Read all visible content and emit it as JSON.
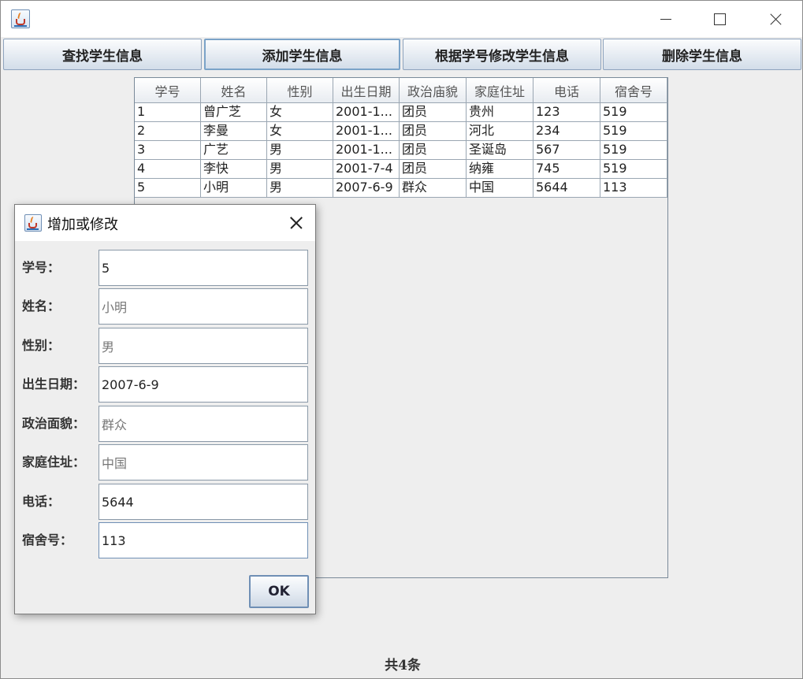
{
  "window": {
    "title": ""
  },
  "toolbar": {
    "find_label": "查找学生信息",
    "add_label": "添加学生信息",
    "modify_label": "根据学号修改学生信息",
    "delete_label": "删除学生信息"
  },
  "table": {
    "columns": [
      "学号",
      "姓名",
      "性别",
      "出生日期",
      "政治庙貌",
      "家庭住址",
      "电话",
      "宿舍号"
    ],
    "rows": [
      [
        "1",
        "曾广芝",
        "女",
        "2001-1...",
        "团员",
        "贵州",
        "123",
        "519"
      ],
      [
        "2",
        "李曼",
        "女",
        "2001-1...",
        "团员",
        "河北",
        "234",
        "519"
      ],
      [
        "3",
        "广艺",
        "男",
        "2001-1...",
        "团员",
        "圣诞岛",
        "567",
        "519"
      ],
      [
        "4",
        "李快",
        "男",
        "2001-7-4",
        "团员",
        "纳雍",
        "745",
        "519"
      ],
      [
        "5",
        "小明",
        "男",
        "2007-6-9",
        "群众",
        "中国",
        "5644",
        "113"
      ]
    ]
  },
  "dialog": {
    "title": "增加或修改",
    "fields": [
      {
        "label": "学号：",
        "value": "5"
      },
      {
        "label": "姓名：",
        "value": "小明"
      },
      {
        "label": "性别：",
        "value": "男"
      },
      {
        "label": "出生日期：",
        "value": "2007-6-9"
      },
      {
        "label": "政治面貌：",
        "value": "群众"
      },
      {
        "label": "家庭住址：",
        "value": "中国"
      },
      {
        "label": "电话：",
        "value": "5644"
      },
      {
        "label": "宿舍号：",
        "value": "113"
      }
    ],
    "ok_label": "OK"
  },
  "footer": {
    "count_label": "共4条"
  }
}
